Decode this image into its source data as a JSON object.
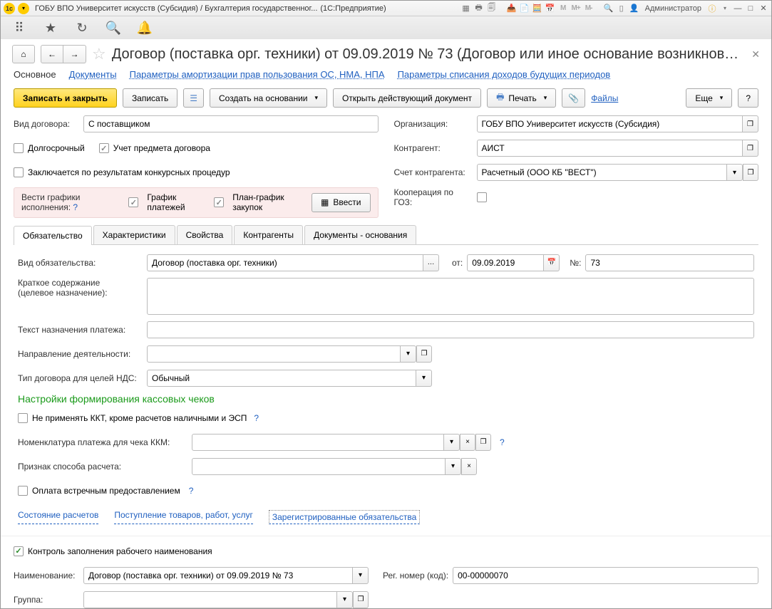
{
  "titlebar": {
    "title1": "ГОБУ ВПО Университет искусств (Субсидия) / Бухгалтерия государственног...",
    "title2": "(1С:Предприятие)",
    "user": "Администратор"
  },
  "header": {
    "title": "Договор (поставка орг. техники) от 09.09.2019 № 73 (Договор или иное основание возникновен..."
  },
  "navtabs": {
    "main": "Основное",
    "docs": "Документы",
    "amort": "Параметры амортизации прав пользования ОС, НМА, НПА",
    "income": "Параметры списания доходов будущих периодов"
  },
  "toolbar": {
    "save_close": "Записать и закрыть",
    "save": "Записать",
    "create_basis": "Создать на основании",
    "open_doc": "Открыть действующий документ",
    "print": "Печать",
    "files": "Файлы",
    "more": "Еще"
  },
  "leftcol": {
    "kind_label": "Вид договора:",
    "kind_value": "С поставщиком",
    "long_term": "Долгосрочный",
    "subject": "Учет предмета договора",
    "tender": "Заключается по результатам конкурсных процедур"
  },
  "rightcol": {
    "org_label": "Организация:",
    "org_value": "ГОБУ ВПО Университет искусств (Субсидия)",
    "contr_label": "Контрагент:",
    "contr_value": "АИСТ",
    "acct_label": "Счет контрагента:",
    "acct_value": "Расчетный (ООО КБ \"ВЕСТ\")",
    "coop_label": "Кооперация по ГОЗ:"
  },
  "pink": {
    "label": "Вести графики исполнения:",
    "chk1": "График платежей",
    "chk2": "План-график закупок",
    "btn": "Ввести"
  },
  "tabs": {
    "t1": "Обязательство",
    "t2": "Характеристики",
    "t3": "Свойства",
    "t4": "Контрагенты",
    "t5": "Документы - основания"
  },
  "obl": {
    "kind_label": "Вид обязательства:",
    "kind_value": "Договор (поставка орг. техники)",
    "from": "от:",
    "date": "09.09.2019",
    "num_label": "№:",
    "num": "73",
    "brief_label1": "Краткое содержание",
    "brief_label2": "(целевое назначение):",
    "pay_text_label": "Текст назначения платежа:",
    "activity_label": "Направление деятельности:",
    "vat_label": "Тип договора для целей НДС:",
    "vat_value": "Обычный",
    "section": "Настройки формирования кассовых чеков",
    "kkt": "Не применять ККТ, кроме расчетов наличными и ЭСП",
    "nom_label": "Номенклатура платежа для чека ККМ:",
    "method_label": "Признак способа расчета:",
    "counter": "Оплата встречным предоставлением",
    "link1": "Состояние расчетов",
    "link2": "Поступление товаров, работ, услуг",
    "link3": "Зарегистрированные обязательства"
  },
  "footer": {
    "chk": "Контроль заполнения рабочего наименования",
    "name_label": "Наименование:",
    "name_value": "Договор (поставка орг. техники) от 09.09.2019 № 73",
    "reg_label": "Рег. номер (код):",
    "reg_value": "00-00000070",
    "group_label": "Группа:"
  }
}
